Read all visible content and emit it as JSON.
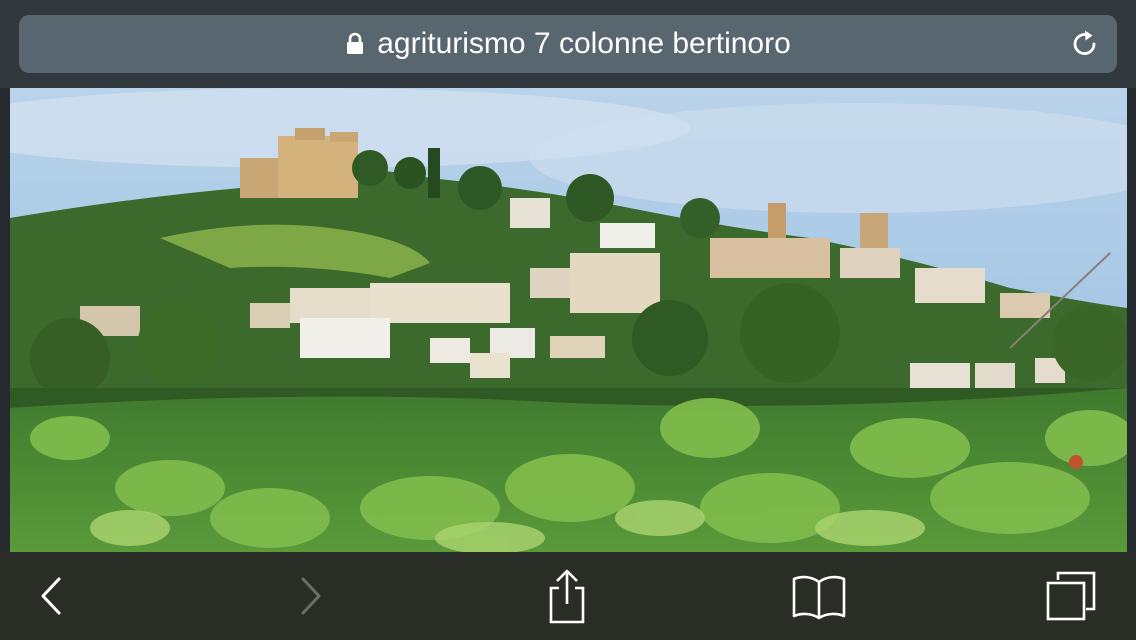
{
  "address_bar": {
    "url_text": "agriturismo 7 colonne bertinoro",
    "secure": true,
    "lock_icon": "lock-icon",
    "reload_icon": "reload-icon"
  },
  "content": {
    "image_subject": "hilltop village photo"
  },
  "toolbar": {
    "back_icon": "chevron-left-icon",
    "forward_icon": "chevron-right-icon",
    "share_icon": "share-icon",
    "bookmarks_icon": "book-icon",
    "tabs_icon": "tabs-icon",
    "forward_enabled": false
  },
  "colors": {
    "top_bar": "#30373d",
    "url_field": "#586670",
    "toolbar": "#2a2d25",
    "icon_active": "#ffffff",
    "icon_disabled": "#6b6e66"
  }
}
